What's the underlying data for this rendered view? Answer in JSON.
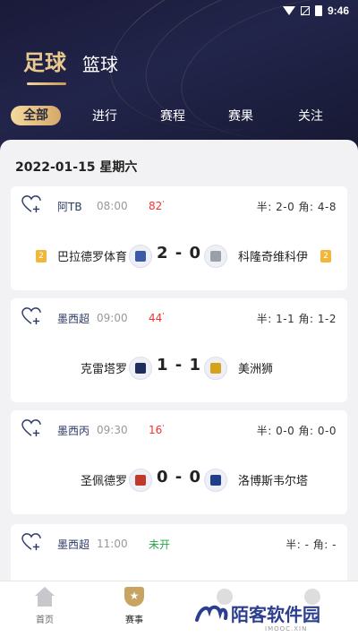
{
  "status_bar": {
    "time": "9:46"
  },
  "sport_tabs": [
    {
      "label": "足球",
      "active": true
    },
    {
      "label": "篮球",
      "active": false
    }
  ],
  "filter_tabs": [
    {
      "label": "全部",
      "active": true
    },
    {
      "label": "进行",
      "active": false
    },
    {
      "label": "赛程",
      "active": false
    },
    {
      "label": "赛果",
      "active": false
    },
    {
      "label": "关注",
      "active": false
    }
  ],
  "date_label": "2022-01-15 星期六",
  "matches": [
    {
      "league": "阿TB",
      "time": "08:00",
      "minute": "82",
      "status": "",
      "stats": "半: 2-0  角: 4-8",
      "home": "巴拉德罗体育",
      "away": "科隆奇维科伊",
      "score": "2 - 0",
      "home_rank": "2",
      "away_rank": "2",
      "home_color": "#3a5aa8",
      "away_color": "#9aa0a8"
    },
    {
      "league": "墨西超",
      "time": "09:00",
      "minute": "44",
      "status": "",
      "stats": "半: 1-1  角: 1-2",
      "home": "克雷塔罗",
      "away": "美洲狮",
      "score": "1 - 1",
      "home_rank": "",
      "away_rank": "",
      "home_color": "#1f2d5c",
      "away_color": "#d4a21b"
    },
    {
      "league": "墨西丙",
      "time": "09:30",
      "minute": "16",
      "status": "",
      "stats": "半: 0-0  角: 0-0",
      "home": "圣佩德罗",
      "away": "洛博斯韦尔塔",
      "score": "0 - 0",
      "home_rank": "",
      "away_rank": "",
      "home_color": "#c0392b",
      "away_color": "#1f3f8a"
    },
    {
      "league": "墨西超",
      "time": "11:00",
      "minute": "",
      "status": "未开",
      "stats": "半: -  角: -",
      "home": "",
      "away": "",
      "score": "",
      "home_rank": "",
      "away_rank": "",
      "home_color": "",
      "away_color": ""
    }
  ],
  "bottom_nav": [
    {
      "label": "首页",
      "icon": "home-icon"
    },
    {
      "label": "赛事",
      "icon": "match-icon"
    }
  ],
  "watermark": {
    "title": "陌客软件园",
    "sub": "IMOOC.XIN"
  },
  "colors": {
    "accent_gold": "#d3a969",
    "live_red": "#e33333",
    "not_started_green": "#2aa34a",
    "header_navy": "#1a1a3a"
  }
}
